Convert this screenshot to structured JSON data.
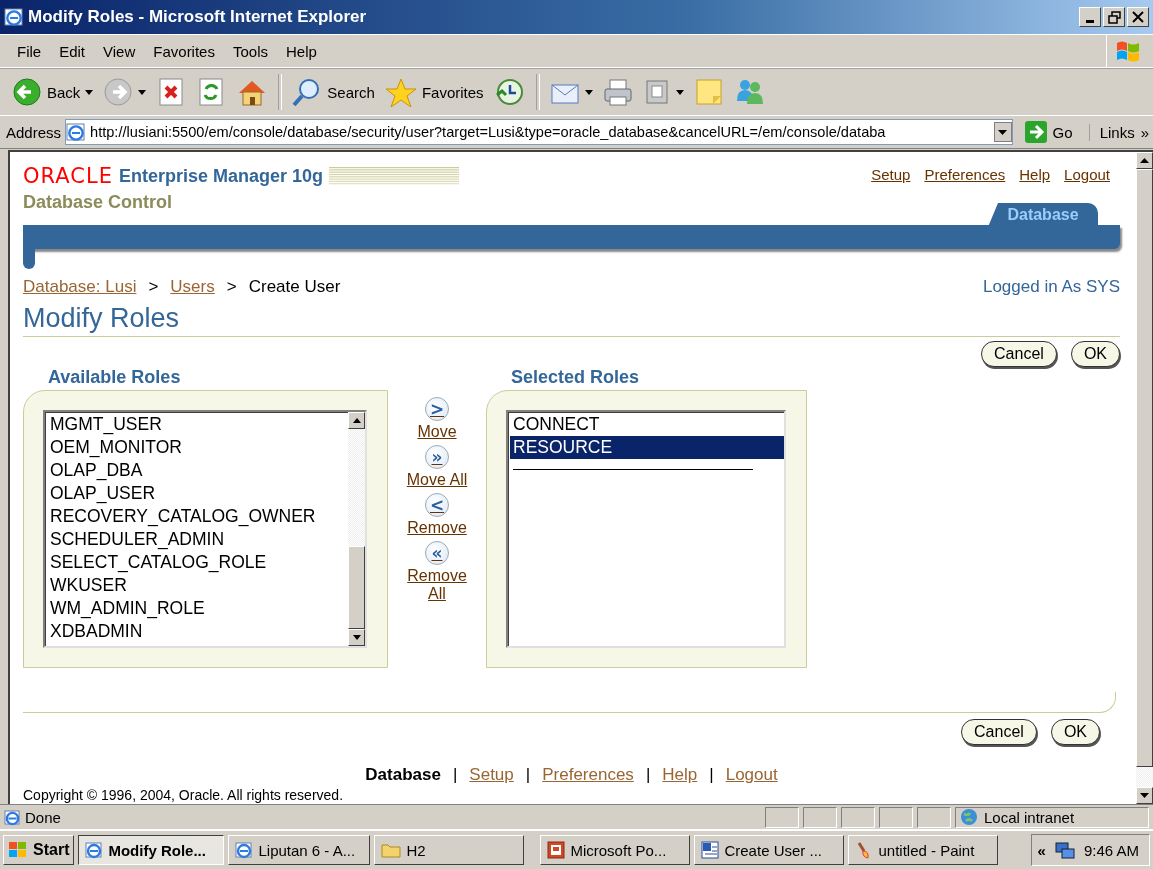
{
  "window": {
    "title": "Modify Roles - Microsoft Internet Explorer"
  },
  "menu": [
    "File",
    "Edit",
    "View",
    "Favorites",
    "Tools",
    "Help"
  ],
  "toolbar": [
    {
      "kind": "back",
      "label": "Back",
      "dropdown": true
    },
    {
      "kind": "forward",
      "dropdown": true
    },
    {
      "kind": "stop"
    },
    {
      "kind": "refresh"
    },
    {
      "kind": "home"
    },
    {
      "kind": "search",
      "label": "Search",
      "separator_before": true
    },
    {
      "kind": "favorites",
      "label": "Favorites"
    },
    {
      "kind": "history"
    },
    {
      "kind": "mail",
      "dropdown": true,
      "separator_before": true
    },
    {
      "kind": "print"
    },
    {
      "kind": "edit",
      "dropdown": true
    },
    {
      "kind": "discuss"
    },
    {
      "kind": "messenger"
    }
  ],
  "address": {
    "label": "Address",
    "url": "http://lusiani:5500/em/console/database/security/user?target=Lusi&type=oracle_database&cancelURL=/em/console/databa",
    "go": "Go",
    "links": "Links",
    "links_chevron": "»"
  },
  "header": {
    "brand": "ORACLE",
    "product": "Enterprise Manager 10g",
    "subtitle": "Database Control",
    "global_links": [
      "Setup",
      "Preferences",
      "Help",
      "Logout"
    ],
    "tab": {
      "label": "Database",
      "selected": true
    }
  },
  "breadcrumb": {
    "items": [
      {
        "label": "Database: Lusi",
        "kind": "link"
      },
      {
        "label": "Users",
        "kind": "link"
      },
      {
        "label": "Create User",
        "kind": "current"
      }
    ],
    "separators": [
      ">",
      ">"
    ]
  },
  "logged_in": "Logged in As SYS",
  "page_title": "Modify Roles",
  "top_buttons": [
    "Cancel",
    "OK"
  ],
  "available_roles": {
    "title": "Available Roles",
    "items": [
      {
        "label": "MGMT_USER",
        "selected": false
      },
      {
        "label": "OEM_MONITOR",
        "selected": false
      },
      {
        "label": "OLAP_DBA",
        "selected": false
      },
      {
        "label": "OLAP_USER",
        "selected": false
      },
      {
        "label": "RECOVERY_CATALOG_OWNER",
        "selected": false
      },
      {
        "label": "SCHEDULER_ADMIN",
        "selected": false
      },
      {
        "label": "SELECT_CATALOG_ROLE",
        "selected": false
      },
      {
        "label": "WKUSER",
        "selected": false
      },
      {
        "label": "WM_ADMIN_ROLE",
        "selected": false
      },
      {
        "label": "XDBADMIN",
        "selected": false
      }
    ]
  },
  "shuttle": [
    {
      "symbol": ">",
      "label": "Move"
    },
    {
      "symbol": "»",
      "label": "Move All"
    },
    {
      "symbol": "<",
      "label": "Remove"
    },
    {
      "symbol": "«",
      "label": "Remove All"
    }
  ],
  "selected_roles": {
    "title": "Selected Roles",
    "items": [
      {
        "label": "CONNECT",
        "selected": false
      },
      {
        "label": "RESOURCE",
        "selected": true
      }
    ]
  },
  "bottom_buttons": [
    "Cancel",
    "OK"
  ],
  "footer_links": [
    {
      "label": "Database",
      "kind": "current"
    },
    {
      "label": "Setup",
      "kind": "link"
    },
    {
      "label": "Preferences",
      "kind": "link"
    },
    {
      "label": "Help",
      "kind": "link"
    },
    {
      "label": "Logout",
      "kind": "link"
    }
  ],
  "footer_separators": [
    "|",
    "|",
    "|",
    "|"
  ],
  "copyright": "Copyright © 1996, 2004, Oracle. All rights reserved.",
  "status_bar": {
    "text": "Done",
    "zone": "Local intranet"
  },
  "taskbar": {
    "start": "Start",
    "tasks": [
      {
        "label": "Modify Role...",
        "kind": "ie",
        "selected": true
      },
      {
        "label": "Liputan 6 - A...",
        "kind": "ie",
        "selected": false
      },
      {
        "label": "H2",
        "kind": "folder",
        "selected": false
      },
      {
        "label": "Microsoft Po...",
        "kind": "powerpoint",
        "selected": false
      },
      {
        "label": "Create User ...",
        "kind": "word",
        "selected": false
      },
      {
        "label": "untitled - Paint",
        "kind": "paint",
        "selected": false
      }
    ],
    "tray_chevron": "«",
    "clock": "9:46 AM"
  }
}
